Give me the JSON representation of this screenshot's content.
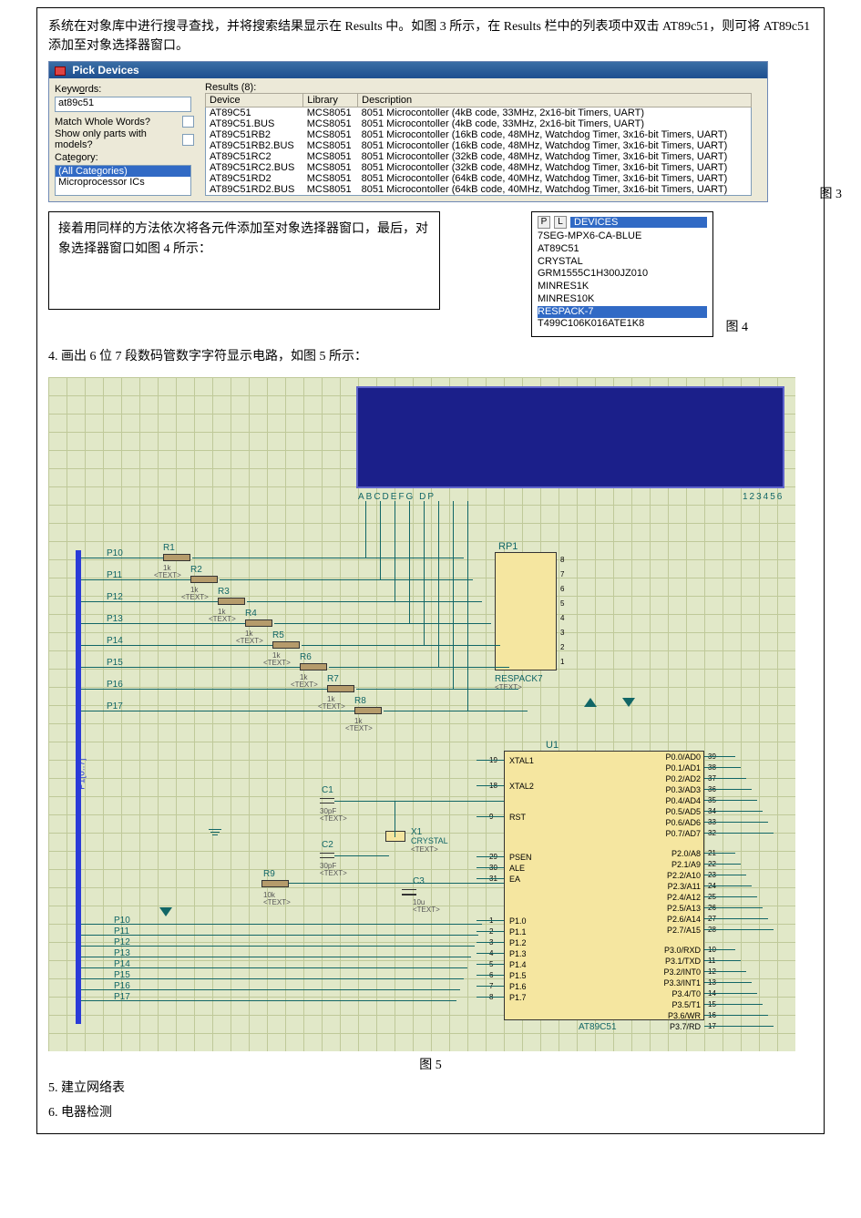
{
  "para1": "系统在对象库中进行搜寻查找，并将搜索结果显示在 Results 中。如图 3 所示，在 Results 栏中的列表项中双击 AT89c51，则可将 AT89c51 添加至对象选择器窗口。",
  "pick": {
    "title": "Pick Devices",
    "keywords_label_pre": "Keyw",
    "keywords_label_u": "o",
    "keywords_label_post": "rds:",
    "keywords_value": "at89c51",
    "match_label_pre": "Match ",
    "match_label_u": "W",
    "match_label_post": "hole Words?",
    "show_label_pre": "Show only parts with ",
    "show_label_u": "m",
    "show_label_post": "odels?",
    "category_label_pre": "Ca",
    "category_label_u": "t",
    "category_label_post": "egory:",
    "cat_selected": "(All Categories)",
    "cat_item": "Microprocessor ICs",
    "results_label_pre": "Res",
    "results_label_u": "u",
    "results_label_post": "lts (8):",
    "cols": {
      "device": "Device",
      "library": "Library",
      "description": "Description"
    },
    "rows": [
      {
        "device": "AT89C51",
        "library": "MCS8051",
        "desc": "8051 Microcontoller (4kB code, 33MHz, 2x16-bit Timers, UART)"
      },
      {
        "device": "AT89C51.BUS",
        "library": "MCS8051",
        "desc": "8051 Microcontoller (4kB code, 33MHz, 2x16-bit Timers, UART)"
      },
      {
        "device": "AT89C51RB2",
        "library": "MCS8051",
        "desc": "8051 Microcontoller (16kB code, 48MHz, Watchdog Timer, 3x16-bit Timers, UART)"
      },
      {
        "device": "AT89C51RB2.BUS",
        "library": "MCS8051",
        "desc": "8051 Microcontoller (16kB code, 48MHz, Watchdog Timer, 3x16-bit Timers, UART)"
      },
      {
        "device": "AT89C51RC2",
        "library": "MCS8051",
        "desc": "8051 Microcontoller (32kB code, 48MHz, Watchdog Timer, 3x16-bit Timers, UART)"
      },
      {
        "device": "AT89C51RC2.BUS",
        "library": "MCS8051",
        "desc": "8051 Microcontoller (32kB code, 48MHz, Watchdog Timer, 3x16-bit Timers, UART)"
      },
      {
        "device": "AT89C51RD2",
        "library": "MCS8051",
        "desc": "8051 Microcontoller (64kB code, 40MHz, Watchdog Timer, 3x16-bit Timers, UART)"
      },
      {
        "device": "AT89C51RD2.BUS",
        "library": "MCS8051",
        "desc": "8051 Microcontoller (64kB code, 40MHz, Watchdog Timer, 3x16-bit Timers, UART)"
      }
    ]
  },
  "fig3": "图 3",
  "textbox": "接着用同样的方法依次将各元件添加至对象选择器窗口，最后，对象选择器窗口如图 4 所示：",
  "devpanel": {
    "btn_p": "P",
    "btn_l": "L",
    "header": "DEVICES",
    "items": [
      "7SEG-MPX6-CA-BLUE",
      "AT89C51",
      "CRYSTAL",
      "GRM1555C1H300JZ010",
      "MINRES1K",
      "MINRES10K",
      "RESPACK-7",
      "T499C106K016ATE1K8"
    ],
    "selected": "RESPACK-7"
  },
  "fig4": "图 4",
  "step4": "4. 画出 6 位 7 段数码管数字字符显示电路，如图 5 所示：",
  "schem": {
    "seg_label_a": "ABCDEFG   DP",
    "seg_label_b": "123456",
    "bus_label": "P1[0..7]",
    "nets_left": [
      "P10",
      "P11",
      "P12",
      "P13",
      "P14",
      "P15",
      "P16",
      "P17"
    ],
    "r_refs": [
      "R1",
      "R2",
      "R3",
      "R4",
      "R5",
      "R6",
      "R7",
      "R8"
    ],
    "r_val": "1k",
    "r_txt": "<TEXT>",
    "rp1_ref": "RP1",
    "rp1_pins": [
      "8",
      "7",
      "6",
      "5",
      "4",
      "3",
      "2",
      "1"
    ],
    "rp1_name": "RESPACK7",
    "u1_ref": "U1",
    "u1_name": "AT89C51",
    "u1_left": [
      {
        "num": "19",
        "name": "XTAL1"
      },
      {
        "num": "18",
        "name": "XTAL2"
      },
      {
        "num": "9",
        "name": "RST"
      },
      {
        "num": "29",
        "name": "PSEN"
      },
      {
        "num": "30",
        "name": "ALE"
      },
      {
        "num": "31",
        "name": "EA"
      },
      {
        "num": "1",
        "name": "P1.0"
      },
      {
        "num": "2",
        "name": "P1.1"
      },
      {
        "num": "3",
        "name": "P1.2"
      },
      {
        "num": "4",
        "name": "P1.3"
      },
      {
        "num": "5",
        "name": "P1.4"
      },
      {
        "num": "6",
        "name": "P1.5"
      },
      {
        "num": "7",
        "name": "P1.6"
      },
      {
        "num": "8",
        "name": "P1.7"
      }
    ],
    "u1_right": [
      {
        "num": "39",
        "name": "P0.0/AD0"
      },
      {
        "num": "38",
        "name": "P0.1/AD1"
      },
      {
        "num": "37",
        "name": "P0.2/AD2"
      },
      {
        "num": "36",
        "name": "P0.3/AD3"
      },
      {
        "num": "35",
        "name": "P0.4/AD4"
      },
      {
        "num": "34",
        "name": "P0.5/AD5"
      },
      {
        "num": "33",
        "name": "P0.6/AD6"
      },
      {
        "num": "32",
        "name": "P0.7/AD7"
      },
      {
        "num": "21",
        "name": "P2.0/A8"
      },
      {
        "num": "22",
        "name": "P2.1/A9"
      },
      {
        "num": "23",
        "name": "P2.2/A10"
      },
      {
        "num": "24",
        "name": "P2.3/A11"
      },
      {
        "num": "25",
        "name": "P2.4/A12"
      },
      {
        "num": "26",
        "name": "P2.5/A13"
      },
      {
        "num": "27",
        "name": "P2.6/A14"
      },
      {
        "num": "28",
        "name": "P2.7/A15"
      },
      {
        "num": "10",
        "name": "P3.0/RXD"
      },
      {
        "num": "11",
        "name": "P3.1/TXD"
      },
      {
        "num": "12",
        "name": "P3.2/INT0"
      },
      {
        "num": "13",
        "name": "P3.3/INT1"
      },
      {
        "num": "14",
        "name": "P3.4/T0"
      },
      {
        "num": "15",
        "name": "P3.5/T1"
      },
      {
        "num": "16",
        "name": "P3.6/WR"
      },
      {
        "num": "17",
        "name": "P3.7/RD"
      }
    ],
    "c1_ref": "C1",
    "c1_val": "30pF",
    "c2_ref": "C2",
    "c2_val": "30pF",
    "c3_ref": "C3",
    "c3_val": "10u",
    "x1_ref": "X1",
    "x1_val": "CRYSTAL",
    "r9_ref": "R9",
    "r9_val": "10k",
    "bot_nets": [
      "P10",
      "P11",
      "P12",
      "P13",
      "P14",
      "P15",
      "P16",
      "P17"
    ]
  },
  "fig5": "图 5",
  "step5": "5. 建立网络表",
  "step6": "6. 电器检测"
}
